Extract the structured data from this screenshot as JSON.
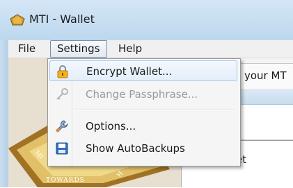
{
  "window": {
    "title": "MTI - Wallet"
  },
  "menubar": {
    "file": "File",
    "settings": "Settings",
    "help": "Help"
  },
  "settings_menu": {
    "items": [
      {
        "label": "Encrypt Wallet...",
        "icon": "lock-icon",
        "enabled": true,
        "highlighted": true
      },
      {
        "label": "Change Passphrase...",
        "icon": "key-icon",
        "enabled": false
      },
      {
        "label": "Options...",
        "icon": "wrench-icon",
        "enabled": true
      },
      {
        "label": "Show AutoBackups",
        "icon": "floppy-disk-icon",
        "enabled": true
      }
    ]
  },
  "background": {
    "header_text": "your MT",
    "lower_text": "et",
    "badge_text_1": "Towards",
    "badge_text_2": "Mi",
    "badge_text_3": "H"
  }
}
